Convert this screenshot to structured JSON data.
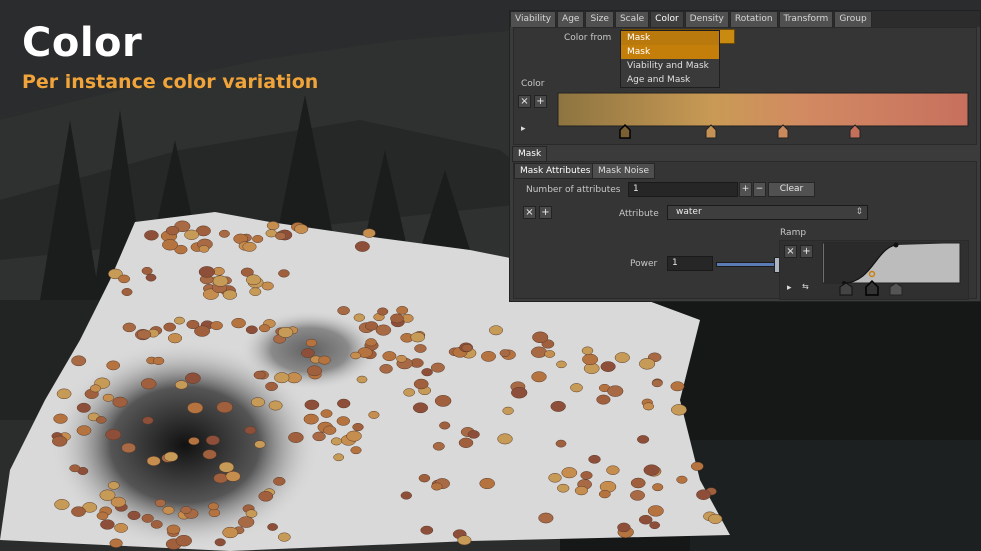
{
  "hero": {
    "title": "Color",
    "subtitle": "Per instance color variation"
  },
  "panel": {
    "tabs": [
      {
        "label": "Viability"
      },
      {
        "label": "Age"
      },
      {
        "label": "Size"
      },
      {
        "label": "Scale"
      },
      {
        "label": "Color",
        "active": true
      },
      {
        "label": "Density"
      },
      {
        "label": "Rotation"
      },
      {
        "label": "Transform"
      },
      {
        "label": "Group"
      }
    ],
    "color_from": {
      "label": "Color from",
      "value": "Mask",
      "options": [
        "Mask",
        "Viability and Mask",
        "Age and Mask"
      ]
    },
    "color_section": {
      "label": "Color",
      "remove_symbol": "×",
      "add_symbol": "+",
      "play_symbol": "▸",
      "gradient_colors": [
        "#8d7440",
        "#c99a55",
        "#d28a62",
        "#c7705e"
      ]
    },
    "mask_section": {
      "tab_label": "Mask",
      "subtabs": [
        {
          "label": "Mask Attributes",
          "active": true
        },
        {
          "label": "Mask Noise"
        }
      ],
      "num_attributes_label": "Number of attributes",
      "num_attributes_value": "1",
      "plus_symbol": "+",
      "minus_symbol": "−",
      "clear_label": "Clear",
      "remove_symbol": "×",
      "add_symbol": "+",
      "attribute_label": "Attribute",
      "attribute_value": "water",
      "ramp_label": "Ramp",
      "power_label": "Power",
      "power_value": "1",
      "power_slider_fraction": 1.0
    }
  },
  "colors": {
    "accent_orange": "#f1a43a",
    "menu_highlight": "#c47f0a",
    "panel_bg": "#3b3b3b"
  }
}
